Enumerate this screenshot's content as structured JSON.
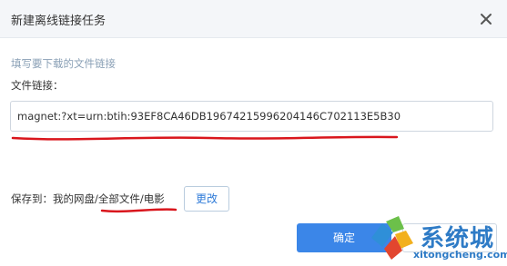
{
  "dialog": {
    "title": "新建离线链接任务",
    "close_icon": "close-icon",
    "hint": "填写要下载的文件链接",
    "link_label": "文件链接：",
    "link_value": "magnet:?xt=urn:btih:93EF8CA46DB19674215996204146C702113E5B30",
    "save_to_prefix": "保存到：",
    "save_to_path": "我的网盘/全部文件/电影",
    "change_button": "更改",
    "confirm_button": "确定"
  },
  "colors": {
    "titlebar_bg": "#f4f6f9",
    "primary_button": "#3b86e8",
    "annotation_red": "#d9161d",
    "watermark_blue": "#2e7bc6"
  },
  "watermark": {
    "brand": "系统城",
    "url": "xitongcheng.com",
    "logo_icon": "windows-logo-icon"
  }
}
